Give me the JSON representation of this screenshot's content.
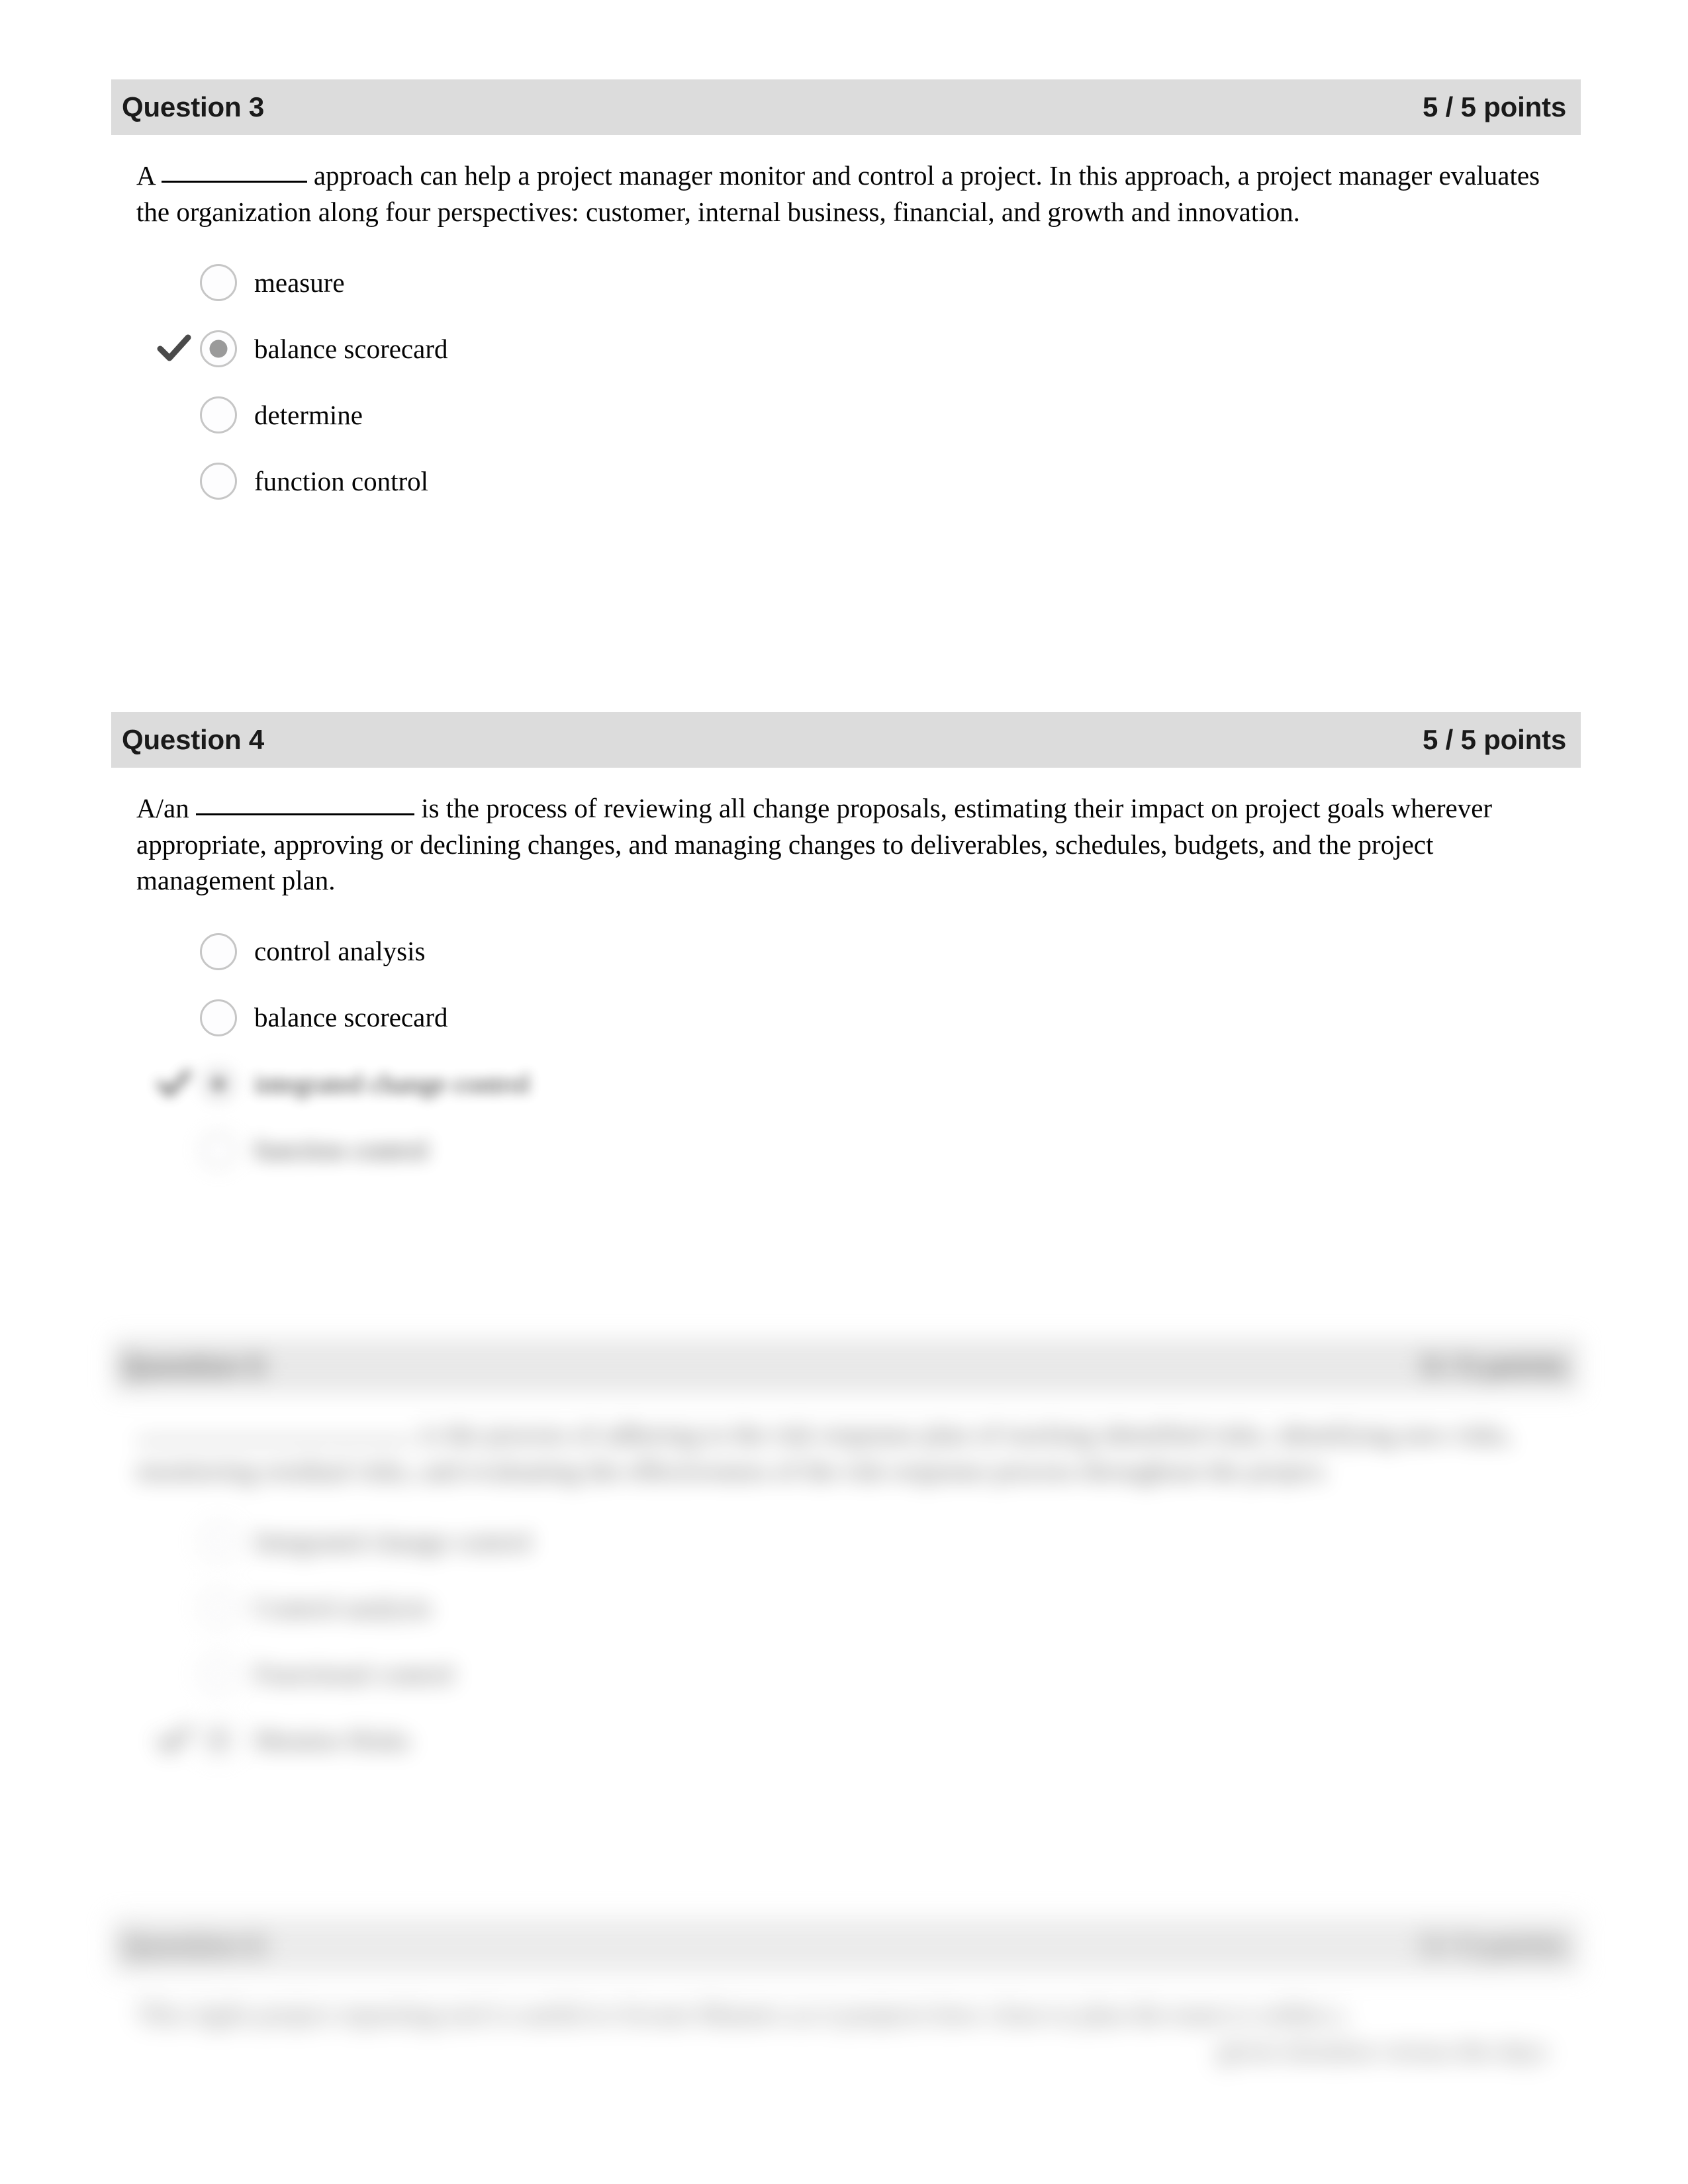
{
  "document": {
    "type": "quiz-results-page"
  },
  "questions": [
    {
      "id": "q3",
      "title": "Question 3",
      "points": "5 / 5 points",
      "text_before_blank": "A",
      "text_after_blank": "approach can help a project manager monitor and control a project. In this approach, a project manager evaluates the organization along four perspectives: customer, internal business, financial, and growth and innovation.",
      "options": [
        {
          "label": "measure",
          "selected": false,
          "correct_mark": false
        },
        {
          "label": "balance scorecard",
          "selected": true,
          "correct_mark": true
        },
        {
          "label": "determine",
          "selected": false,
          "correct_mark": false
        },
        {
          "label": "function control",
          "selected": false,
          "correct_mark": false
        }
      ]
    },
    {
      "id": "q4",
      "title": "Question 4",
      "points": "5 / 5 points",
      "text_before_blank": "A/an",
      "text_after_blank": "is the process of reviewing all change proposals, estimating their impact on project goals wherever appropriate, approving or declining changes, and managing changes to deliverables, schedules, budgets, and the project management plan.",
      "options": [
        {
          "label": "control analysis",
          "selected": false,
          "correct_mark": false
        },
        {
          "label": "balance scorecard",
          "selected": false,
          "correct_mark": false
        },
        {
          "label": "integrated change control",
          "selected": true,
          "correct_mark": true
        },
        {
          "label": "function control",
          "selected": false,
          "correct_mark": false
        }
      ]
    },
    {
      "id": "q5",
      "title": "Question 5",
      "points": "5 / 5 points",
      "text_before_blank": "",
      "text_after_blank": "is the process of adhering to the risk response plan of tracking identified risks, identifying new risks, monitoring residual risks, and evaluating the effectiveness of the risk response process throughout the project.",
      "options": [
        {
          "label": "Integrated change control",
          "selected": false,
          "correct_mark": false
        },
        {
          "label": "Control analysis",
          "selected": false,
          "correct_mark": false
        },
        {
          "label": "Functional control",
          "selected": false,
          "correct_mark": false
        },
        {
          "label": "Monitor Risks",
          "selected": true,
          "correct_mark": true
        }
      ]
    },
    {
      "id": "q6",
      "title": "Question 6",
      "points": "5 / 5 points",
      "text_line1": "This Agile project reporting tool is useful to Scrum Masters as it projects how close to plan the team is within a",
      "text_line2": "given iteration versus the days",
      "options": []
    }
  ]
}
